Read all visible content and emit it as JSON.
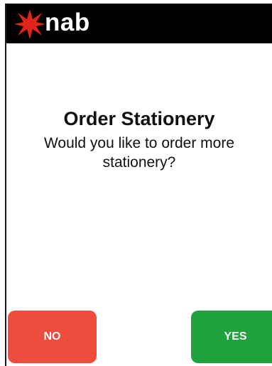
{
  "header": {
    "brand": "nab",
    "logo_icon": "nab-star-icon",
    "background_color": "#000000",
    "logo_color": "#e2231a"
  },
  "dialog": {
    "title": "Order Stationery",
    "message": "Would you like to order more stationery?"
  },
  "buttons": {
    "no_label": "NO",
    "yes_label": "YES",
    "no_color": "#ee4c3c",
    "yes_color": "#1fa13b"
  }
}
